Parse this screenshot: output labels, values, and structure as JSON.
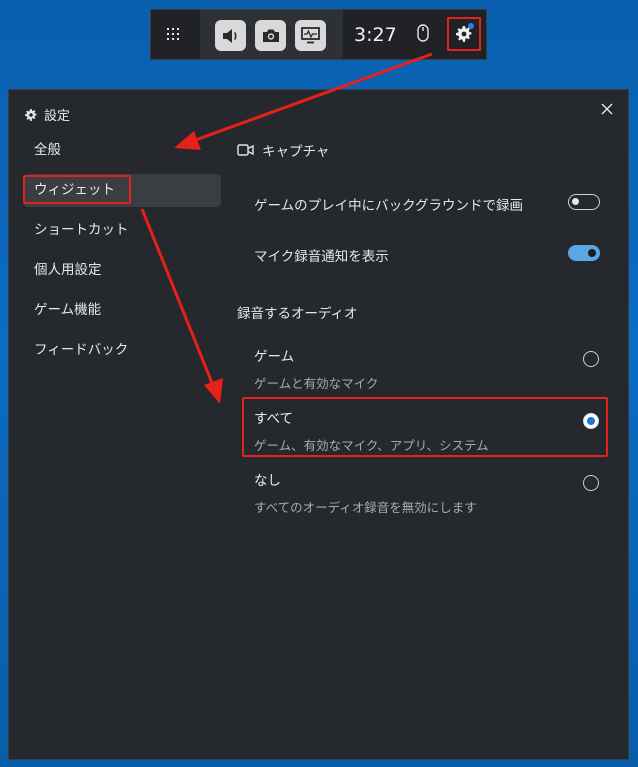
{
  "gamebar": {
    "time": "3:27",
    "buttons": [
      {
        "icon": "volume-icon"
      },
      {
        "icon": "camera-icon"
      },
      {
        "icon": "performance-monitor-icon"
      }
    ],
    "notification_color": "#2f7ee8"
  },
  "settings": {
    "title": "設定",
    "close_label": "✕",
    "nav": [
      {
        "label": "全般",
        "selected": false
      },
      {
        "label": "ウィジェット",
        "selected": true
      },
      {
        "label": "ショートカット",
        "selected": false
      },
      {
        "label": "個人用設定",
        "selected": false
      },
      {
        "label": "ゲーム機能",
        "selected": false
      },
      {
        "label": "フィードバック",
        "selected": false
      }
    ],
    "capture": {
      "section_title": "キャプチャ",
      "toggles": [
        {
          "label": "ゲームのプレイ中にバックグラウンドで録画",
          "on": false
        },
        {
          "label": "マイク録音通知を表示",
          "on": true
        }
      ],
      "audio_heading": "録音するオーディオ",
      "audio_options": [
        {
          "label": "ゲーム",
          "desc": "ゲームと有効なマイク",
          "checked": false
        },
        {
          "label": "すべて",
          "desc": "ゲーム、有効なマイク、アプリ、システム",
          "checked": true
        },
        {
          "label": "なし",
          "desc": "すべてのオーディオ録音を無効にします",
          "checked": false
        }
      ]
    }
  },
  "annotation_color": "#e6201b",
  "accent_color": "#1a78d6"
}
